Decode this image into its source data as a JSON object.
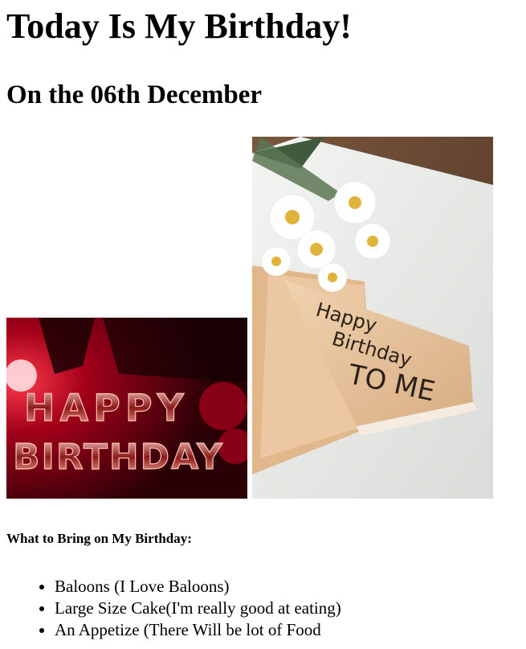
{
  "page": {
    "title": "Today Is My Birthday!",
    "subtitle": "On the 06th December"
  },
  "images": {
    "left": {
      "icon": "birthday-balloons-image",
      "text": "HAPPY BIRTHDAY"
    },
    "right": {
      "icon": "birthday-notebook-flowers-image",
      "text_line1": "Happy",
      "text_line2": "Birthday",
      "text_line3": "TO ME"
    }
  },
  "bring_section": {
    "heading": "What to Bring on My Birthday:",
    "items": [
      "Baloons (I Love Baloons)",
      "Large Size Cake(I'm really good at eating)",
      "An Appetize (There Will be lot of Food"
    ]
  },
  "colors": {
    "text": "#000000",
    "background": "#ffffff",
    "balloon_red": "#b0001a",
    "paper": "#e9c9a3",
    "sand": "#6b4a34"
  }
}
